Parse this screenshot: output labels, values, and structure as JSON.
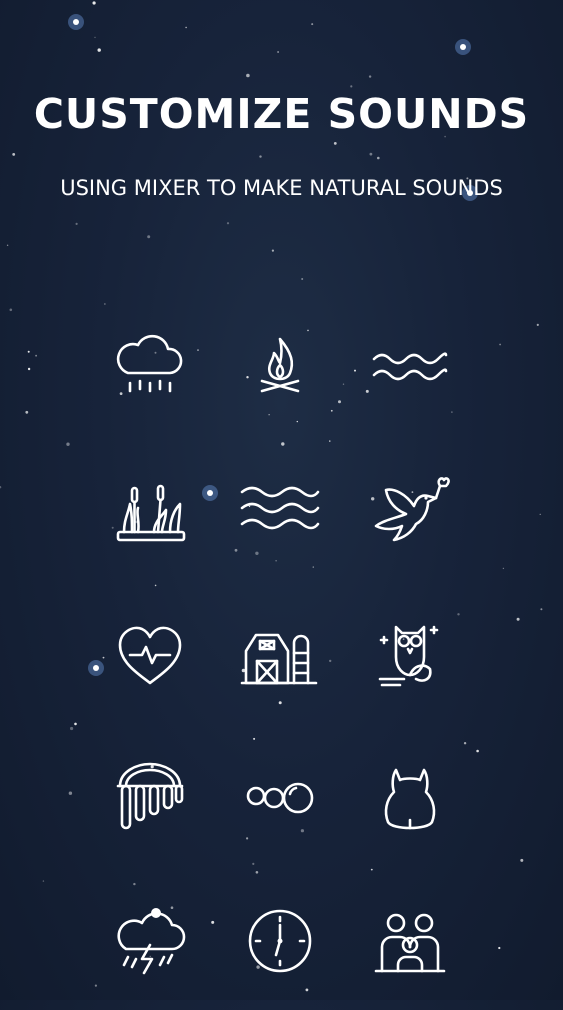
{
  "screen": {
    "title": "CUSTOMIZE SOUNDS",
    "subtitle": "USING MIXER TO MAKE NATURAL SOUNDS"
  },
  "sounds": [
    {
      "icon": "rain-cloud-icon"
    },
    {
      "icon": "campfire-icon"
    },
    {
      "icon": "ocean-waves-icon"
    },
    {
      "icon": "marsh-reeds-icon"
    },
    {
      "icon": "wind-waves-icon"
    },
    {
      "icon": "dove-bird-icon"
    },
    {
      "icon": "heartbeat-icon"
    },
    {
      "icon": "farm-barn-icon"
    },
    {
      "icon": "owl-night-icon"
    },
    {
      "icon": "wind-chimes-icon"
    },
    {
      "icon": "bubbles-icon"
    },
    {
      "icon": "cat-icon"
    },
    {
      "icon": "thunderstorm-icon"
    },
    {
      "icon": "clock-icon"
    },
    {
      "icon": "crowd-people-icon"
    }
  ],
  "colors": {
    "background": "#17233a",
    "foreground": "#ffffff",
    "star_glow": "#7fb2ff"
  }
}
